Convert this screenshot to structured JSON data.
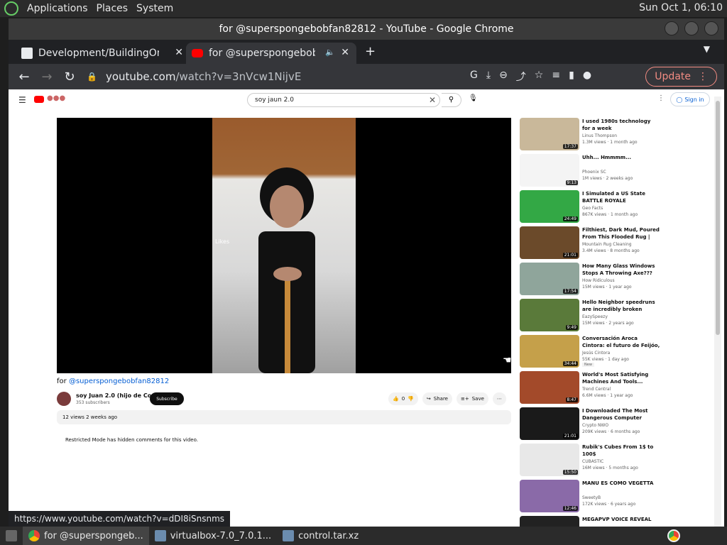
{
  "system_bar": {
    "menu": [
      "Applications",
      "Places",
      "System"
    ],
    "clock": "Sun Oct 1, 06:10"
  },
  "window": {
    "title": "for @superspongebobfan82812 - YouTube - Google Chrome"
  },
  "tabs": [
    {
      "label": "Development/BuildingOnLinux",
      "active": false
    },
    {
      "label": "for @superspongebobfan8",
      "active": true
    }
  ],
  "toolbar": {
    "url_host": "youtube.com",
    "url_path": "/watch?v=3nVcw1NijvE",
    "update_label": "Update"
  },
  "youtube": {
    "search_value": "soy jaun 2.0",
    "signin_label": "Sign in",
    "video_title_prefix": "for ",
    "video_title_mention": "@superspongebobfan82812",
    "overlay_likes": "Likes",
    "channel_name": "soy Juan 2.0 (hijo de Cos)",
    "subscribers": "353 subscribers",
    "subscribe_label": "Subscribe",
    "like_count": "0",
    "share_label": "Share",
    "save_label": "Save",
    "desc_stats": "12 views  2 weeks ago",
    "restricted_notice": "Restricted Mode has hidden comments for this video."
  },
  "recommendations": [
    {
      "title": "I used 1980s technology for a week",
      "channel": "Linus Thompson",
      "meta": "1.3M views · 1 month ago",
      "duration": "17:37",
      "color": "#c9b89a"
    },
    {
      "title": "Uhh... Hmmmm...",
      "channel": "Phoenix SC",
      "meta": "1M views · 2 weeks ago",
      "duration": "9:13",
      "color": "#f4f4f4"
    },
    {
      "title": "I Simulated a US State BATTLE ROYALE",
      "channel": "Geo Facts",
      "meta": "867K views · 1 month ago",
      "duration": "24:49",
      "color": "#33a845"
    },
    {
      "title": "Filthiest, Dark Mud, Poured From This Flooded Rug | Carpe...",
      "channel": "Mountain Rug Cleaning",
      "meta": "3.4M views · 8 months ago",
      "duration": "21:01",
      "color": "#6b4a2a"
    },
    {
      "title": "How Many Glass Windows Stops A Throwing Axe???",
      "channel": "How Ridiculous",
      "meta": "15M views · 1 year ago",
      "duration": "17:54",
      "color": "#8fa59b"
    },
    {
      "title": "Hello Neighbor speedruns are incredibly broken",
      "channel": "EazySpeezy",
      "meta": "15M views · 2 years ago",
      "duration": "9:49",
      "color": "#5a7a3a"
    },
    {
      "title": "Conversación Aroca Cintora: el futuro de Feijóo, ¿Gobierno?...",
      "channel": "Jesús Cintora",
      "meta": "55K views · 1 day ago",
      "duration": "34:44",
      "color": "#c5a04a",
      "badge": "New"
    },
    {
      "title": "World's Most Satisfying Machines And Tools...",
      "channel": "Trend Central",
      "meta": "6.6M views · 1 year ago",
      "duration": "8:47",
      "color": "#a34a2a"
    },
    {
      "title": "I Downloaded The Most Dangerous Computer Viruses 6",
      "channel": "Crypto NWO",
      "meta": "209K views · 6 months ago",
      "duration": "21:01",
      "color": "#1a1a1a"
    },
    {
      "title": "Rubik's Cubes From 1$ to 100$",
      "channel": "CUBASTIC",
      "meta": "16M views · 5 months ago",
      "duration": "15:50",
      "color": "#e8e8e8"
    },
    {
      "title": "MANU ES COMO VEGETTA",
      "channel": "SweetyB",
      "meta": "172K views · 6 years ago",
      "duration": "12:46",
      "color": "#8a6aa8"
    },
    {
      "title": "MEGAPVP VOICE REVEAL",
      "channel": "",
      "meta": "",
      "duration": "",
      "color": "#222222"
    }
  ],
  "status_url": "https://www.youtube.com/watch?v=dDI8iSnsnms",
  "taskbar": [
    {
      "label": "for @superspongeb...",
      "active": true
    },
    {
      "label": "virtualbox-7.0_7.0.1...",
      "active": false
    },
    {
      "label": "control.tar.xz",
      "active": false
    }
  ]
}
